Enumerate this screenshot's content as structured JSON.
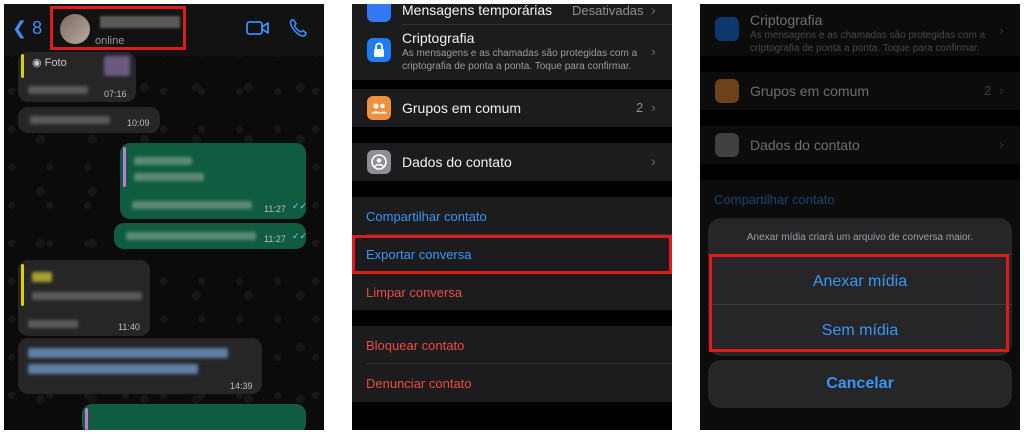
{
  "chat": {
    "back_count": "8",
    "status": "online",
    "photo_label": "Foto",
    "times": [
      "07:16",
      "10:09",
      "11:27",
      "11:27",
      "11:40",
      "14:39"
    ]
  },
  "settings": {
    "disappearing_label": "Mensagens temporárias",
    "disappearing_value": "Desativadas",
    "encryption_label": "Criptografia",
    "encryption_desc": "As mensagens e as chamadas são protegidas com a criptografia de ponta a ponta. Toque para confirmar.",
    "groups_label": "Grupos em comum",
    "groups_count": "2",
    "contact_details_label": "Dados do contato",
    "share_contact": "Compartilhar contato",
    "export_chat": "Exportar conversa",
    "clear_chat": "Limpar conversa",
    "block_contact": "Bloquear contato",
    "report_contact": "Denunciar contato"
  },
  "sheet": {
    "message": "Anexar mídia criará um arquivo de conversa maior.",
    "attach_media": "Anexar mídia",
    "no_media": "Sem mídia",
    "cancel": "Cancelar"
  },
  "colors": {
    "accent": "#3a97f5",
    "destructive": "#eb4c42",
    "highlight": "#e01b1b",
    "outgoing": "#105c40"
  }
}
